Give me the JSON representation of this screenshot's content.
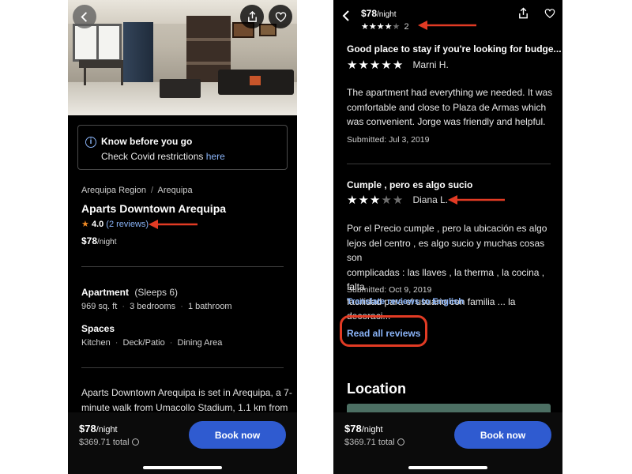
{
  "left": {
    "info_box": {
      "title": "Know before you go",
      "desc": "Check Covid restrictions",
      "link": "here"
    },
    "breadcrumb": {
      "region": "Arequipa Region",
      "separator": "/",
      "city": "Arequipa"
    },
    "property_name": "Aparts Downtown Arequipa",
    "rating": {
      "score": "4.0",
      "reviews": "(2 reviews)"
    },
    "price": {
      "amount": "$78",
      "unit": "/night"
    },
    "apartment": {
      "title": "Apartment",
      "sleeps": "(Sleeps 6)"
    },
    "specs": [
      "969 sq. ft",
      "3 bedrooms",
      "1 bathroom"
    ],
    "spaces": {
      "title": "Spaces",
      "items": [
        "Kitchen",
        "Deck/Patio",
        "Dining Area"
      ]
    },
    "description": {
      "line1": "Aparts Downtown Arequipa is set in Arequipa, a 7-",
      "line2": "minute walk from Umacollo Stadium, 1.1 km from"
    },
    "footer": {
      "price": "$78",
      "unit": "/night",
      "total": "$369.71 total",
      "book": "Book now"
    }
  },
  "right": {
    "header": {
      "price": "$78",
      "unit": "/night",
      "rating_count": "2",
      "stars_filled": 4
    },
    "reviews": [
      {
        "title": "Good place to stay if you're looking for budge...",
        "stars_filled": 5,
        "author": "Marni H.",
        "lines": [
          "The apartment had everything we needed. It was",
          "comfortable and close to Plaza de Armas which",
          "was convenient. Jorge was friendly and helpful."
        ],
        "submitted": "Submitted: Jul 3, 2019"
      },
      {
        "title": "Cumple , pero es algo sucio",
        "stars_filled": 3,
        "author": "Diana L.",
        "lines": [
          "Por el Precio cumple , pero la ubicación es algo",
          "lejos del centro , es algo sucio y muchas cosas son",
          "complicadas : las llaves , la therma , la cocina , falta",
          "facilidad para el usuario con familia ... la decoraci..."
        ],
        "submitted": "Submitted: Oct 9, 2019",
        "translate": "Translate reviews to English"
      }
    ],
    "read_all": "Read all reviews",
    "location_title": "Location",
    "footer": {
      "price": "$78",
      "unit": "/night",
      "total": "$369.71 total",
      "book": "Book now"
    }
  },
  "colors": {
    "accent_link": "#8ab4f8",
    "book_button": "#2f5bd0",
    "annotation_red": "#e23b24",
    "star_orange": "#f08a24"
  }
}
